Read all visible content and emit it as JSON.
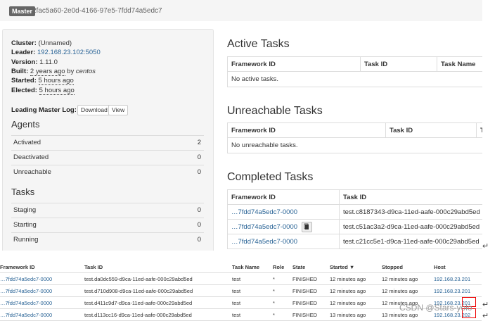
{
  "header": {
    "badge": "Master",
    "master_id": "2fac5a60-2e0d-4166-97e5-7fdd74a5edc7"
  },
  "info": {
    "cluster_label": "Cluster:",
    "cluster_value": "(Unnamed)",
    "leader_label": "Leader:",
    "leader_value": "192.168.23.102:5050",
    "version_label": "Version:",
    "version_value": "1.11.0",
    "built_label": "Built:",
    "built_ago": "2 years ago",
    "built_by": "by",
    "built_user": "centos",
    "started_label": "Started:",
    "started_value": "5 hours ago",
    "elected_label": "Elected:",
    "elected_value": "5 hours ago",
    "log_label": "Leading Master Log:",
    "download_label": "Download",
    "view_label": "View"
  },
  "agents": {
    "title": "Agents",
    "rows": [
      {
        "label": "Activated",
        "value": "2"
      },
      {
        "label": "Deactivated",
        "value": "0"
      },
      {
        "label": "Unreachable",
        "value": "0"
      }
    ]
  },
  "tasks": {
    "title": "Tasks",
    "rows": [
      {
        "label": "Staging",
        "value": "0"
      },
      {
        "label": "Starting",
        "value": "0"
      },
      {
        "label": "Running",
        "value": "0"
      }
    ]
  },
  "active_tasks": {
    "title": "Active Tasks",
    "columns": [
      "Framework ID",
      "Task ID",
      "Task Name"
    ],
    "empty": "No active tasks."
  },
  "unreachable_tasks": {
    "title": "Unreachable Tasks",
    "columns": [
      "Framework ID",
      "Task ID",
      "T"
    ],
    "empty": "No unreachable tasks."
  },
  "completed_tasks": {
    "title": "Completed Tasks",
    "columns": [
      "Framework ID",
      "Task ID"
    ],
    "rows": [
      {
        "framework": "…7fdd74a5edc7-0000",
        "task": "test.c8187343-d9ca-11ed-aafe-000c29abd5ed"
      },
      {
        "framework": "…7fdd74a5edc7-0000",
        "task": "test.c51ac3a2-d9ca-11ed-aafe-000c29abd5ed"
      },
      {
        "framework": "…7fdd74a5edc7-0000",
        "task": "test.c21cc5e1-d9ca-11ed-aafe-000c29abd5ed"
      }
    ]
  },
  "bottom_table": {
    "columns": [
      "Framework ID",
      "Task ID",
      "Task Name",
      "Role",
      "State",
      "Started ▼",
      "Stopped",
      "Host"
    ],
    "rows": [
      {
        "framework": "…7fdd74a5edc7-0000",
        "task": "test.da0dc559-d9ca-11ed-aafe-000c29abd5ed",
        "name": "test",
        "role": "*",
        "state": "FINISHED",
        "started": "12 minutes ago",
        "stopped": "12 minutes ago",
        "host": "192.168.23.201"
      },
      {
        "framework": "…7fdd74a5edc7-0000",
        "task": "test.d710d908-d9ca-11ed-aafe-000c29abd5ed",
        "name": "test",
        "role": "*",
        "state": "FINISHED",
        "started": "12 minutes ago",
        "stopped": "12 minutes ago",
        "host": "192.168.23.201"
      },
      {
        "framework": "…7fdd74a5edc7-0000",
        "task": "test.d411c9d7-d9ca-11ed-aafe-000c29abd5ed",
        "name": "test",
        "role": "*",
        "state": "FINISHED",
        "started": "12 minutes ago",
        "stopped": "12 minutes ago",
        "host": "192.168.23.201"
      },
      {
        "framework": "…7fdd74a5edc7-0000",
        "task": "test.d113cc16-d9ca-11ed-aafe-000c29abd5ed",
        "name": "test",
        "role": "*",
        "state": "FINISHED",
        "started": "13 minutes ago",
        "stopped": "13 minutes ago",
        "host": "192.168.23.202"
      }
    ]
  },
  "watermark": "CSDN @Stars-yolo",
  "return_symbol": "↵",
  "colors": {
    "link": "#2a6496",
    "highlight": "#ee0000"
  }
}
